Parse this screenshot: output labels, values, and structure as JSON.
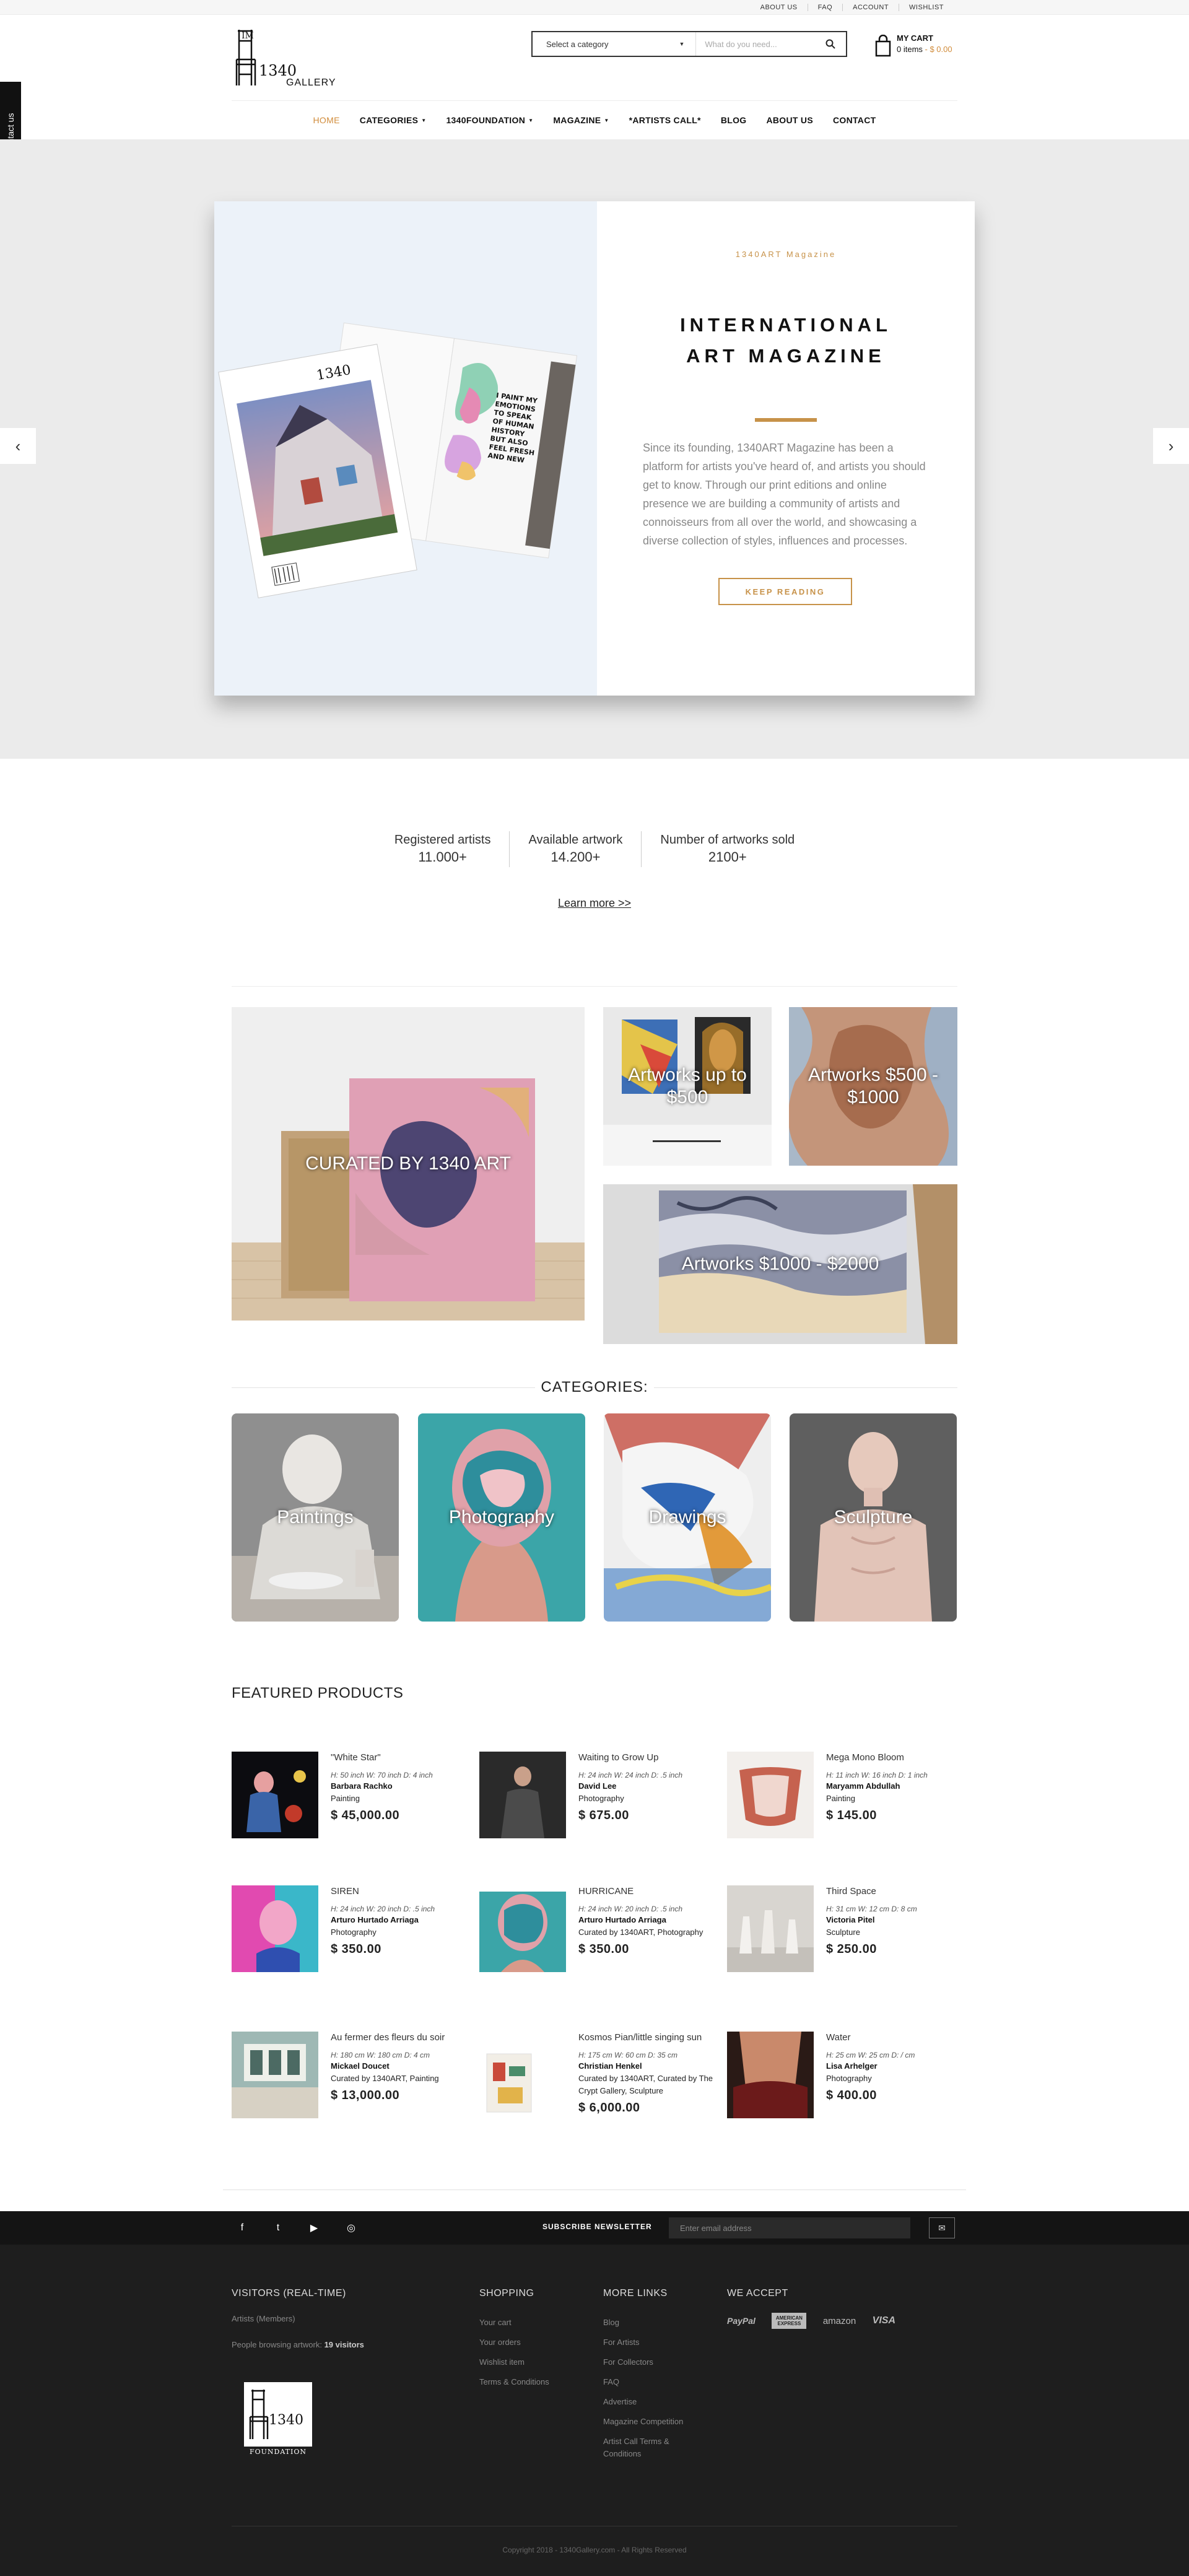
{
  "topbar": {
    "links": [
      "ABOUT US",
      "FAQ",
      "ACCOUNT",
      "WISHLIST"
    ]
  },
  "logo": {
    "text": "1340",
    "subtitle": "GALLERY"
  },
  "search": {
    "category_label": "Select a category",
    "placeholder": "What do you need..."
  },
  "cart": {
    "title": "MY CART",
    "items": "0 items",
    "separator": " - ",
    "amount": "$ 0.00"
  },
  "nav": {
    "items": [
      {
        "label": "HOME",
        "dropdown": false
      },
      {
        "label": "CATEGORIES",
        "dropdown": true
      },
      {
        "label": "1340FOUNDATION",
        "dropdown": true
      },
      {
        "label": "MAGAZINE",
        "dropdown": true
      },
      {
        "label": "*ARTISTS CALL*",
        "dropdown": false
      },
      {
        "label": "BLOG",
        "dropdown": false
      },
      {
        "label": "ABOUT US",
        "dropdown": false
      },
      {
        "label": "CONTACT",
        "dropdown": false
      }
    ]
  },
  "contact_tab": "Contact us",
  "hero": {
    "kicker": "1340ART Magazine",
    "title_line1": "INTERNATIONAL",
    "title_line2": "ART MAGAZINE",
    "description": "Since its founding, 1340ART Magazine has been a platform for artists you've heard of, and artists you should get to know. Through our print editions and online presence we are building a community of artists and connoisseurs from all over the world, and showcasing a diverse collection of styles, influences and processes.",
    "button": "KEEP READING",
    "prev_icon": "‹",
    "next_icon": "›"
  },
  "stats": [
    {
      "label": "Registered artists",
      "value": "11.000+"
    },
    {
      "label": "Available artwork",
      "value": "14.200+"
    },
    {
      "label": "Number of artworks sold",
      "value": "2100+"
    }
  ],
  "learn_more": "Learn more >>",
  "promos": {
    "curated": "CURATED BY 1340 ART",
    "upto500": "Artworks up to $500",
    "range500": "Artworks $500 - $1000",
    "range1000": "Artworks $1000 - $2000"
  },
  "categories": {
    "title": "CATEGORIES:",
    "items": [
      "Paintings",
      "Photography",
      "Drawings",
      "Sculpture"
    ]
  },
  "featured": {
    "title": "FEATURED PRODUCTS",
    "products": [
      {
        "name": "\"White Star\"",
        "dims": "H: 50 inch W: 70 inch D: 4 inch",
        "artist": "Barbara Rachko",
        "category": "Painting",
        "price": "$ 45,000.00"
      },
      {
        "name": "Waiting to Grow Up",
        "dims": "H: 24 inch W: 24 inch D: .5 inch",
        "artist": "David Lee",
        "category": "Photography",
        "price": "$ 675.00"
      },
      {
        "name": "Mega Mono Bloom",
        "dims": "H: 11 inch W: 16 inch D: 1 inch",
        "artist": "Maryamm Abdullah",
        "category": "Painting",
        "price": "$ 145.00"
      },
      {
        "name": "SIREN",
        "dims": "H: 24 inch W: 20 inch D: .5 inch",
        "artist": "Arturo Hurtado Arriaga",
        "category": "Photography",
        "price": "$ 350.00"
      },
      {
        "name": "HURRICANE",
        "dims": "H: 24 inch W: 20 inch D: .5 inch",
        "artist": "Arturo Hurtado Arriaga",
        "category": "Curated by 1340ART, Photography",
        "price": "$ 350.00"
      },
      {
        "name": "Third Space",
        "dims": "H: 31 cm W: 12 cm D: 8 cm",
        "artist": "Victoria Pitel",
        "category": "Sculpture",
        "price": "$ 250.00"
      },
      {
        "name": "Au fermer des fleurs du soir",
        "dims": "H: 180 cm W: 180 cm D: 4 cm",
        "artist": "Mickael Doucet",
        "category": "Curated by 1340ART, Painting",
        "price": "$ 13,000.00"
      },
      {
        "name": "Kosmos Pian/little singing sun",
        "dims": "H: 175 cm W: 60 cm D: 35 cm",
        "artist": "Christian Henkel",
        "category": "Curated by 1340ART, Curated by The Crypt Gallery, Sculpture",
        "price": "$ 6,000.00"
      },
      {
        "name": "Water",
        "dims": "H: 25 cm W: 25 cm D: / cm",
        "artist": "Lisa Arhelger",
        "category": "Photography",
        "price": "$ 400.00"
      }
    ]
  },
  "footer": {
    "social": [
      "f",
      "t",
      "▶",
      "◎"
    ],
    "newsletter_label": "SUBSCRIBE NEWSLETTER",
    "newsletter_placeholder": "Enter email address",
    "newsletter_icon": "✉",
    "visitors": {
      "title": "VISITORS (REAL-TIME)",
      "members": "Artists (Members)",
      "browsing_prefix": "People browsing artwork: ",
      "browsing_count": "19 visitors"
    },
    "shopping": {
      "title": "SHOPPING",
      "links": [
        "Your cart",
        "Your orders",
        "Wishlist item",
        "Terms & Conditions"
      ]
    },
    "more_links": {
      "title": "MORE LINKS",
      "links": [
        "Blog",
        "For Artists",
        "For Collectors",
        "FAQ",
        "Advertise",
        "Magazine Competition",
        "Artist Call Terms & Conditions"
      ]
    },
    "we_accept": {
      "title": "WE ACCEPT",
      "methods": [
        "PayPal",
        "AMERICAN EXPRESS",
        "amazon",
        "VISA"
      ]
    },
    "foundation_logo_text": "1340",
    "foundation_logo_sub": "FOUNDATION",
    "copyright": "Copyright 2018 - 1340Gallery.com - All Rights Reserved"
  },
  "colors": {
    "accent": "#d18c3b",
    "gold": "#c79249",
    "footer_bg": "#1e1e1e",
    "hero_bg": "#ebebeb"
  }
}
